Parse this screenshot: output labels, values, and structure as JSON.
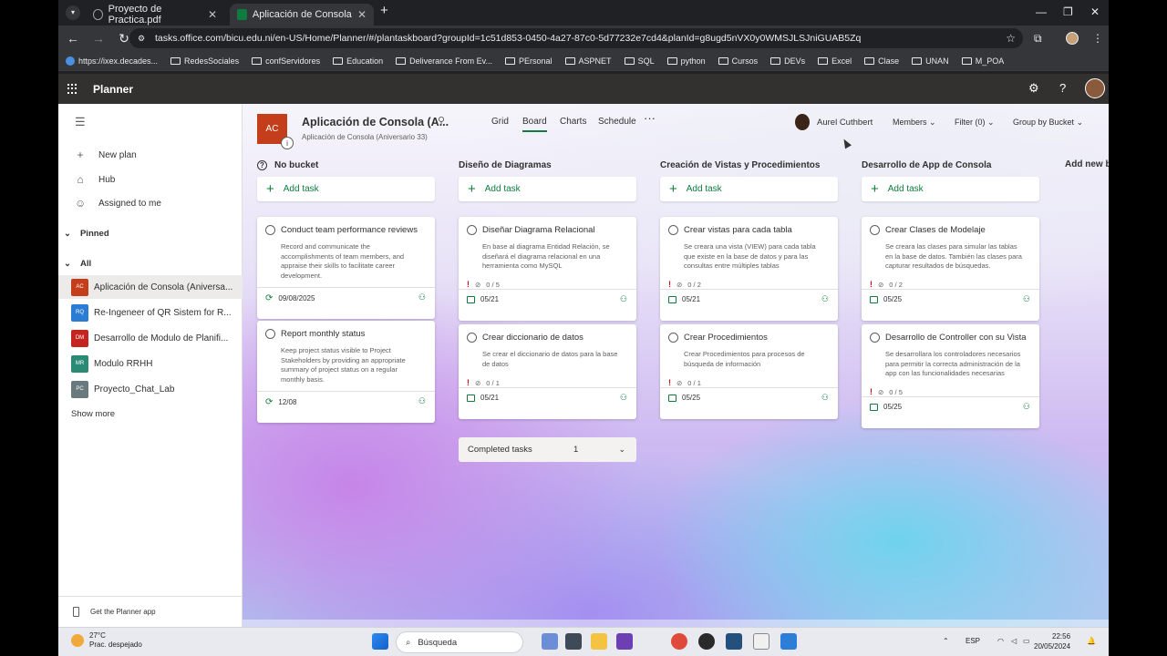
{
  "browser": {
    "tabs": [
      {
        "title": "Proyecto de Practica.pdf"
      },
      {
        "title": "Aplicación de Consola (Aniversa"
      }
    ],
    "url": "tasks.office.com/bicu.edu.ni/en-US/Home/Planner/#/plantaskboard?groupId=1c51d853-0450-4a27-87c0-5d77232e7cd4&planId=g8ugd5nVX0y0WMSJLSJniGUAB5Zq",
    "bookmarks": [
      "https://ixex.decades...",
      "RedesSociales",
      "confServidores",
      "Education",
      "Deliverance From Ev...",
      "PErsonal",
      "ASPNET",
      "SQL",
      "python",
      "Cursos",
      "DEVs",
      "Excel",
      "Clase",
      "UNAN",
      "M_POA"
    ]
  },
  "app": {
    "title": "Planner"
  },
  "nav": {
    "new_plan": "New plan",
    "hub": "Hub",
    "assigned": "Assigned to me",
    "pinned": "Pinned",
    "all": "All",
    "plans": [
      {
        "badge": "AC",
        "name": "Aplicación de Consola (Aniversa...",
        "color": "#c43e1c"
      },
      {
        "badge": "RQ",
        "name": "Re-Ingeneer of QR Sistem for R...",
        "color": "#2b7cd3"
      },
      {
        "badge": "DM",
        "name": "Desarrollo de Modulo de Planifi...",
        "color": "#c4261f"
      },
      {
        "badge": "MR",
        "name": "Modulo RRHH",
        "color": "#2a8a76"
      },
      {
        "badge": "PC",
        "name": "Proyecto_Chat_Lab",
        "color": "#69797e"
      }
    ],
    "show_more": "Show more",
    "get_app": "Get the Planner app"
  },
  "plan": {
    "badge": "AC",
    "title": "Aplicación de Consola (A...",
    "subtitle": "Aplicación de Consola (Aniversario 33)",
    "views": [
      "Grid",
      "Board",
      "Charts",
      "Schedule"
    ],
    "more": "···",
    "user": "Aurel Cuthbert",
    "members": "Members",
    "filter": "Filter (0)",
    "group": "Group by Bucket",
    "add_bucket": "Add new bu"
  },
  "board": {
    "add_task": "Add task",
    "buckets": [
      {
        "name": "No bucket",
        "cards": [
          {
            "title": "Conduct team performance reviews",
            "desc": "Record and communicate the accomplishments of team members, and appraise their skills to facilitate career development.",
            "date": "09/08/2025"
          },
          {
            "title": "Report monthly status",
            "desc": "Keep project status visible to Project Stakeholders by providing an appropriate summary of project status on a regular monthly basis.",
            "date": "12/08"
          }
        ]
      },
      {
        "name": "Diseño de Diagramas",
        "cards": [
          {
            "title": "Diseñar Diagrama Relacional",
            "desc": "En base al diagrama Entidad Relación, se diseñará el diagrama relacional en una herramienta como MySQL",
            "check": "0 / 5",
            "date": "05/21"
          },
          {
            "title": "Crear diccionario de datos",
            "desc": "Se crear el diccionario de datos para la base de datos",
            "check": "0 / 1",
            "date": "05/21"
          }
        ]
      },
      {
        "name": "Creación de Vistas y Procedimientos",
        "cards": [
          {
            "title": "Crear vistas para cada tabla",
            "desc": "Se creara una vista (VIEW) para cada tabla que existe en la base de datos y para las consultas entre múltiples tablas",
            "check": "0 / 2",
            "date": "05/21"
          },
          {
            "title": "Crear Procedimientos",
            "desc": "Crear Procedimientos para procesos de búsqueda de información",
            "check": "0 / 1",
            "date": "05/25"
          }
        ]
      },
      {
        "name": "Desarrollo de App de Consola",
        "cards": [
          {
            "title": "Crear Clases de Modelaje",
            "desc": "Se creara las clases para simular las tablas en la base de datos. También las clases para capturar resultados de búsquedas.",
            "check": "0 / 2",
            "date": "05/25"
          },
          {
            "title": "Desarrollo de Controller con su Vista",
            "desc": "Se desarrollara los controladores necesarios para permitir la correcta administración de la app con las funcionalidades necesarias",
            "check": "0 / 5",
            "date": "05/25"
          }
        ]
      }
    ],
    "completed_label": "Completed tasks",
    "completed_count": "1"
  },
  "taskbar": {
    "temp": "27°C",
    "weather": "Prac. despejado",
    "search": "Búsqueda",
    "lang": "ESP",
    "time": "22:56",
    "date": "20/05/2024"
  }
}
